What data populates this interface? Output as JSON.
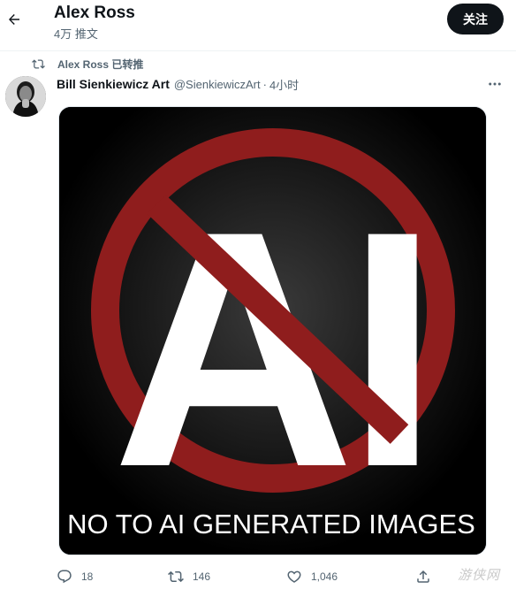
{
  "header": {
    "title": "Alex Ross",
    "subtitle": "4万 推文",
    "follow_label": "关注"
  },
  "retweet": {
    "label": "Alex Ross 已转推"
  },
  "tweet": {
    "author_name": "Bill Sienkiewicz Art",
    "author_handle": "@SienkiewiczArt",
    "separator": "·",
    "time": "4小时",
    "image": {
      "big_text": "AI",
      "caption": "NO TO AI GENERATED IMAGES",
      "symbol_color": "#8f1d1d",
      "background_color": "#000000"
    }
  },
  "actions": {
    "reply_count": "18",
    "retweet_count": "146",
    "like_count": "1,046"
  },
  "watermark": {
    "text": "游侠网"
  },
  "colors": {
    "text_primary": "#0f1419",
    "text_secondary": "#536471",
    "button_dark": "#0f1419"
  }
}
